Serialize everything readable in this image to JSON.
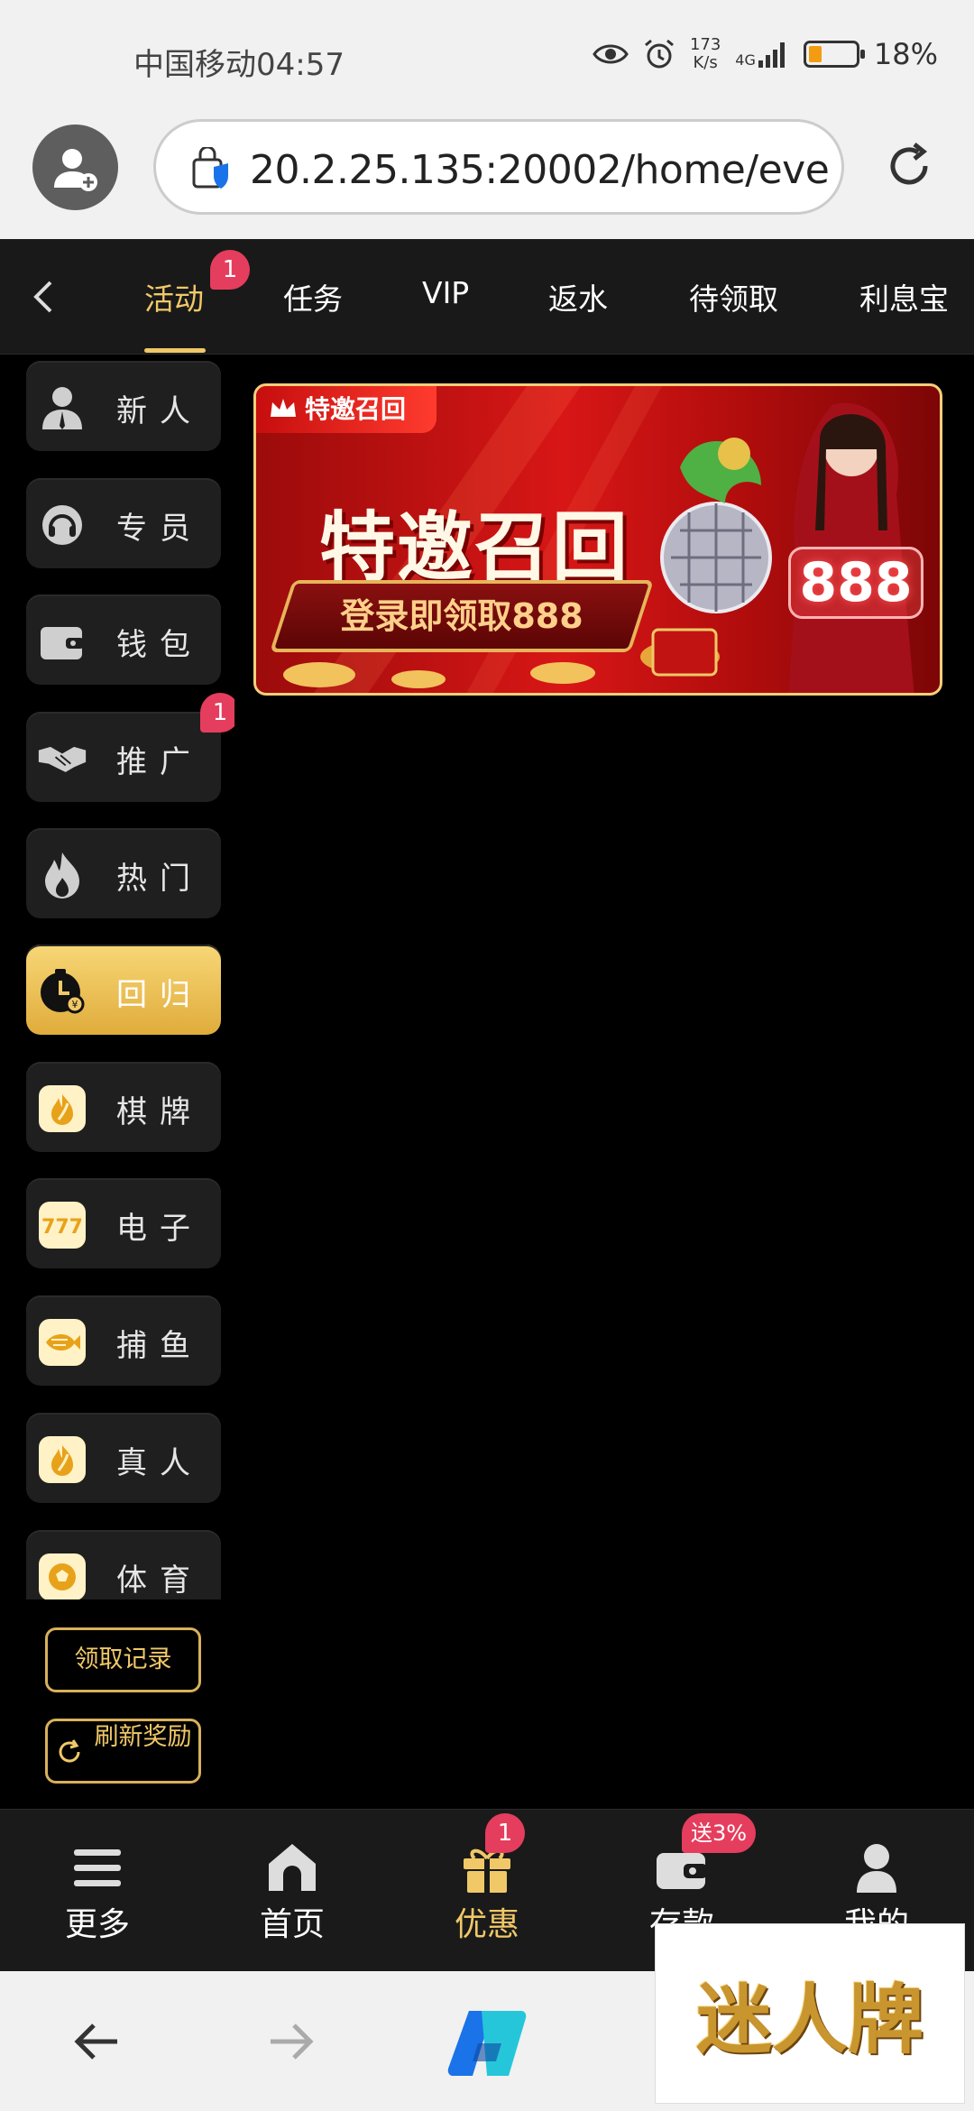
{
  "status_bar": {
    "carrier": "中国移动",
    "time": "04:57",
    "net_speed_value": "173",
    "net_speed_unit": "K/s",
    "network": "4G",
    "battery": "18%"
  },
  "address_bar": {
    "url": "20.2.25.135:20002/home/eve"
  },
  "top_tabs": [
    {
      "label": "活动",
      "active": true,
      "badge": "1"
    },
    {
      "label": "任务"
    },
    {
      "label": "VIP"
    },
    {
      "label": "返水"
    },
    {
      "label": "待领取"
    },
    {
      "label": "利息宝"
    }
  ],
  "sidebar": {
    "items": [
      {
        "label": "新人",
        "icon": "user-icon"
      },
      {
        "label": "专员",
        "icon": "headset-icon"
      },
      {
        "label": "钱包",
        "icon": "wallet-icon"
      },
      {
        "label": "推广",
        "icon": "handshake-icon",
        "badge": "1"
      },
      {
        "label": "热门",
        "icon": "fire-icon"
      },
      {
        "label": "回归",
        "icon": "clock-icon",
        "active": true
      },
      {
        "label": "棋牌",
        "icon": "flame-icon"
      },
      {
        "label": "电子",
        "icon": "slot-777-icon"
      },
      {
        "label": "捕鱼",
        "icon": "fish-icon"
      },
      {
        "label": "真人",
        "icon": "flame-icon"
      },
      {
        "label": "体育",
        "icon": "soccer-ball-icon"
      }
    ],
    "claim_record": "领取记录",
    "refresh_rewards": "刷新奖励"
  },
  "banner": {
    "tag": "特邀召回",
    "title": "特邀召回",
    "subtitle": "登录即领取888",
    "sign": "888"
  },
  "bottom_nav": [
    {
      "label": "更多",
      "icon": "menu-icon"
    },
    {
      "label": "首页",
      "icon": "home-icon"
    },
    {
      "label": "优惠",
      "icon": "gift-icon",
      "active": true,
      "badge": "1"
    },
    {
      "label": "存款",
      "icon": "wallet-icon",
      "badge": "送3%"
    },
    {
      "label": "我的",
      "icon": "user-icon"
    }
  ],
  "watermark": "迷人牌",
  "colors": {
    "accent": "#f0c867",
    "badge": "#e53d5d",
    "background": "#000000",
    "panel": "#1f1f1f"
  }
}
